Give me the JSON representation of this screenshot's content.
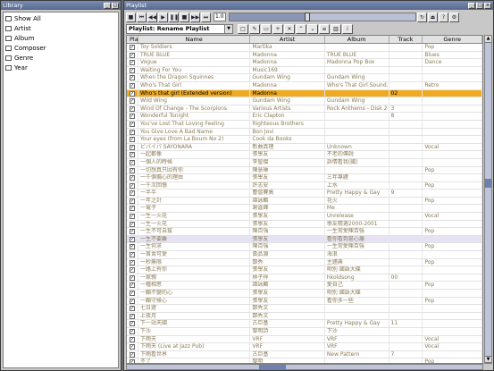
{
  "library": {
    "title": "Library",
    "items": [
      "Show All",
      "Artist",
      "Album",
      "Composer",
      "Genre",
      "Year"
    ]
  },
  "playlist": {
    "title": "Playlist",
    "speed": "1.0",
    "progress": 0.42,
    "selector_label": "Playlist: Rename Playlist",
    "columns": [
      "Play",
      "Name",
      "Artist",
      "Album",
      "Track",
      "Genre"
    ],
    "rows": [
      {
        "name": "Toy Soldiers",
        "artist": "Martika",
        "album": "",
        "track": "",
        "genre": "Pop"
      },
      {
        "name": "TRUE BLUE",
        "artist": "Madonna",
        "album": "TRUE BLUE",
        "track": "",
        "genre": "Blues"
      },
      {
        "name": "Vogue",
        "artist": "Madonna",
        "album": "Madonna Pop Box",
        "track": "",
        "genre": "Dance"
      },
      {
        "name": "Waiting For You",
        "artist": "Music169",
        "album": "",
        "track": "",
        "genre": ""
      },
      {
        "name": "When the Dragon Squinnes",
        "artist": "Gundam Wing",
        "album": "Gundam Wing",
        "track": "",
        "genre": ""
      },
      {
        "name": "Who's That Girl",
        "artist": "Madonna",
        "album": "Who's That Girl Sound...",
        "track": "",
        "genre": "Retro"
      },
      {
        "name": "Who's that girl (Extended version)",
        "artist": "Madonna",
        "album": "",
        "track": "02",
        "genre": ""
      },
      {
        "name": "Wild Wing",
        "artist": "Gundam Wing",
        "album": "Gundam Wing",
        "track": "",
        "genre": ""
      },
      {
        "name": "Wind Of Change - The Scorpions",
        "artist": "Various Artists",
        "album": "Rock Anthems - Disk 2",
        "track": "3",
        "genre": ""
      },
      {
        "name": "Wonderful Tonight",
        "artist": "Eric Clapton",
        "album": "",
        "track": "8",
        "genre": ""
      },
      {
        "name": "You've Lost That Loving Feeling",
        "artist": "Righteous Brothers",
        "album": "",
        "track": "",
        "genre": ""
      },
      {
        "name": "You Give Love A Bad Name",
        "artist": "Bon Jovi",
        "album": "",
        "track": "",
        "genre": ""
      },
      {
        "name": "Your eyes (from La Boum No 2)",
        "artist": "Cook da Books",
        "album": "",
        "track": "",
        "genre": ""
      },
      {
        "name": "ビバイバ SAYONARA",
        "artist": "新曲真理",
        "album": "Unknown",
        "track": "",
        "genre": "Vocal"
      },
      {
        "name": "一起都像",
        "artist": "張學友",
        "album": "不老的傳說",
        "track": "",
        "genre": ""
      },
      {
        "name": "一個人的時候",
        "artist": "李聖傑",
        "album": "訴情看我(國)",
        "track": "",
        "genre": ""
      },
      {
        "name": "一切想真只因有你",
        "artist": "陳慧琳",
        "album": "",
        "track": "",
        "genre": "Pop"
      },
      {
        "name": "一千個傷心的理由",
        "artist": "張學友",
        "album": "三年專題",
        "track": "",
        "genre": ""
      },
      {
        "name": "一千次回憶",
        "artist": "許志安",
        "album": "上水",
        "track": "",
        "genre": "Pop"
      },
      {
        "name": "一半半",
        "artist": "曹晉賽高",
        "album": "Pretty Happy & Gay",
        "track": "9",
        "genre": ""
      },
      {
        "name": "一年之計",
        "artist": "譚詠麟",
        "album": "花火",
        "track": "",
        "genre": "Pop"
      },
      {
        "name": "一電子",
        "artist": "謝霆鋒",
        "album": "Me",
        "track": "",
        "genre": ""
      },
      {
        "name": "一生一火花",
        "artist": "張學友",
        "album": "Unrelease",
        "track": "",
        "genre": "Vocal"
      },
      {
        "name": "一生一火花",
        "artist": "張學友",
        "album": "學友精選2000-2001",
        "track": "",
        "genre": ""
      },
      {
        "name": "一生不可自拔",
        "artist": "陳百強",
        "album": "一生常愛陳百強",
        "track": "",
        "genre": "Pop"
      },
      {
        "name": "一生不要離",
        "artist": "張學友",
        "album": "看你看到甚心痛",
        "track": "",
        "genre": ""
      },
      {
        "name": "一生何求",
        "artist": "陳百強",
        "album": "一生常愛陳百強",
        "track": "",
        "genre": "Pop"
      },
      {
        "name": "一首賣可愛",
        "artist": "黃品源",
        "album": "海浪",
        "track": "",
        "genre": ""
      },
      {
        "name": "一秒無限",
        "artist": "鄭秀",
        "album": "主題典",
        "track": "",
        "genre": "Pop"
      },
      {
        "name": "一路上有你",
        "artist": "張學友",
        "album": "吻別 國語大碟",
        "track": "",
        "genre": ""
      },
      {
        "name": "一家親",
        "artist": "林子祥",
        "album": "hkoldsong",
        "track": "00",
        "genre": ""
      },
      {
        "name": "一種相思",
        "artist": "譚詠麟",
        "album": "愛自己",
        "track": "",
        "genre": "Pop"
      },
      {
        "name": "一顆不變的心",
        "artist": "張學友",
        "album": "吻別 國語大碟",
        "track": "",
        "genre": ""
      },
      {
        "name": "一顆守候心",
        "artist": "張學友",
        "album": "看你多一些",
        "track": "",
        "genre": "Pop"
      },
      {
        "name": "七日遊",
        "artist": "鄭秀文",
        "album": "",
        "track": "",
        "genre": ""
      },
      {
        "name": "上夜月",
        "artist": "鄭秀文",
        "album": "",
        "track": "",
        "genre": ""
      },
      {
        "name": "下一站天國",
        "artist": "古巨基",
        "album": "Pretty Happy & Gay",
        "track": "11",
        "genre": ""
      },
      {
        "name": "下沙",
        "artist": "黎明詩",
        "album": "下沙",
        "track": "",
        "genre": ""
      },
      {
        "name": "下雨天",
        "artist": "VRF",
        "album": "VRF",
        "track": "",
        "genre": "Vocal"
      },
      {
        "name": "下雨天 (Live at Jazz Pub)",
        "artist": "VRF",
        "album": "VRF",
        "track": "",
        "genre": "Vocal"
      },
      {
        "name": "下雨看世界",
        "artist": "古巨基",
        "album": "New Pattern",
        "track": "7",
        "genre": ""
      },
      {
        "name": "不了",
        "artist": "黎明",
        "album": "",
        "track": "",
        "genre": "Pop"
      }
    ]
  }
}
